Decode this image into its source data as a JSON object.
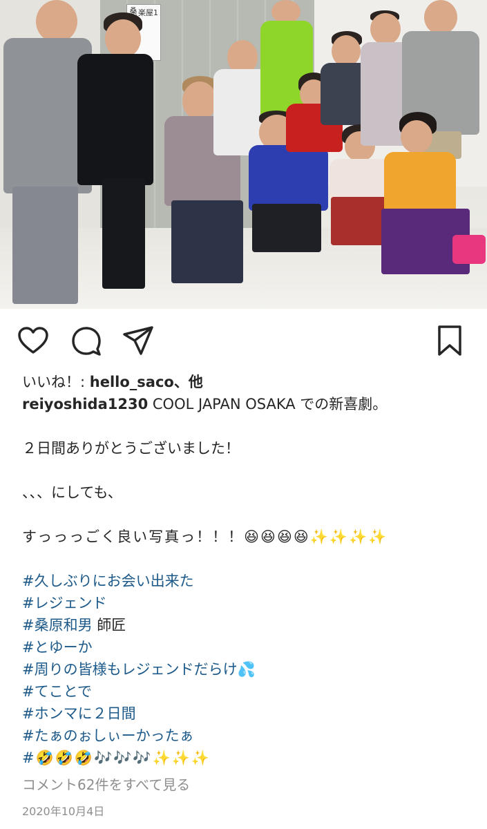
{
  "post": {
    "door_sign": {
      "room": "楽屋1",
      "name": "桑原和男 様"
    },
    "likes_prefix": "いいね！: ",
    "likes_user": "hello_saco",
    "likes_suffix": "、他",
    "username": "reiyoshida1230",
    "caption_first": " COOL JAPAN OSAKA での新喜劇。",
    "caption_lines": [
      "２日間ありがとうございました！",
      "、、、にしても、",
      "すっっっごく良い写真っ！！！😆😆😆😆✨✨✨✨"
    ],
    "hashtags": [
      {
        "tag": "#久しぶりにお会い出来た",
        "suffix": ""
      },
      {
        "tag": "#レジェンド",
        "suffix": ""
      },
      {
        "tag": "#桑原和男",
        "suffix": " 師匠"
      },
      {
        "tag": "#とゆーか",
        "suffix": ""
      },
      {
        "tag": "#周りの皆様もレジェンドだらけ",
        "suffix": "💦"
      },
      {
        "tag": "#てことで",
        "suffix": ""
      },
      {
        "tag": "#ホンマに２日間",
        "suffix": ""
      },
      {
        "tag": "#たぁのぉしぃーかったぁ",
        "suffix": ""
      },
      {
        "tag": "#",
        "suffix": "🤣🤣🤣🎶🎶🎶✨✨✨"
      }
    ],
    "comments_link": "コメント62件をすべて見る",
    "date": "2020年10月4日"
  },
  "icons": {
    "like": "heart-icon",
    "comment": "comment-icon",
    "share": "send-icon",
    "save": "bookmark-icon"
  },
  "colors": {
    "text": "#262626",
    "hashtag": "#1d5a8a",
    "muted": "#8e8e8e"
  }
}
